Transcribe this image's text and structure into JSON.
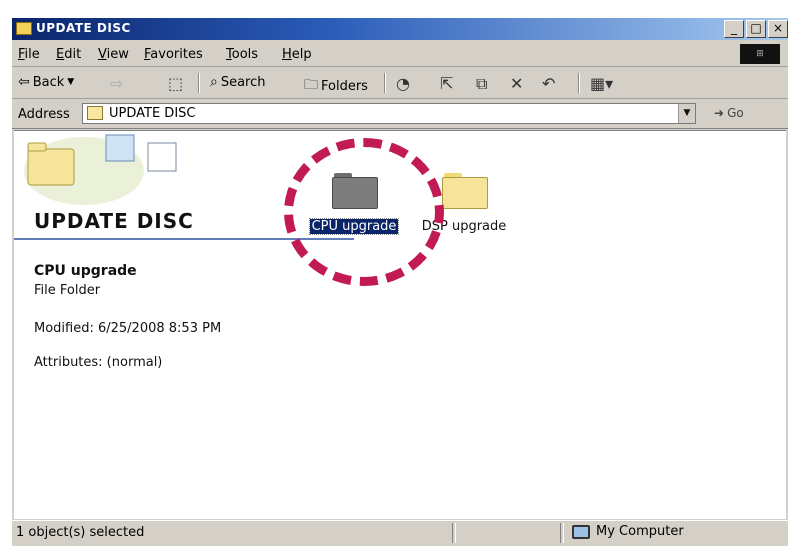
{
  "window": {
    "title": "UPDATE DISC",
    "controls": {
      "minimize": "_",
      "maximize": "□",
      "close": "×"
    }
  },
  "menubar": {
    "items": [
      "File",
      "Edit",
      "View",
      "Favorites",
      "Tools",
      "Help"
    ]
  },
  "toolbar": {
    "back_label": "Back",
    "search_label": "Search",
    "folders_label": "Folders"
  },
  "addressbar": {
    "label": "Address",
    "value": "UPDATE DISC",
    "go_label": "Go"
  },
  "content": {
    "folder_title": "UPDATE DISC",
    "details": {
      "name": "CPU upgrade",
      "type": "File Folder",
      "modified": "Modified: 6/25/2008 8:53 PM",
      "attributes": "Attributes: (normal)"
    },
    "items": [
      {
        "label": "CPU upgrade",
        "selected": true,
        "color": "#7d7d7d"
      },
      {
        "label": "DSP upgrade",
        "selected": false,
        "color": "#f5e49a"
      }
    ],
    "highlight_color": "#c21a55"
  },
  "statusbar": {
    "selection": "1 object(s) selected",
    "zone": "My Computer"
  }
}
